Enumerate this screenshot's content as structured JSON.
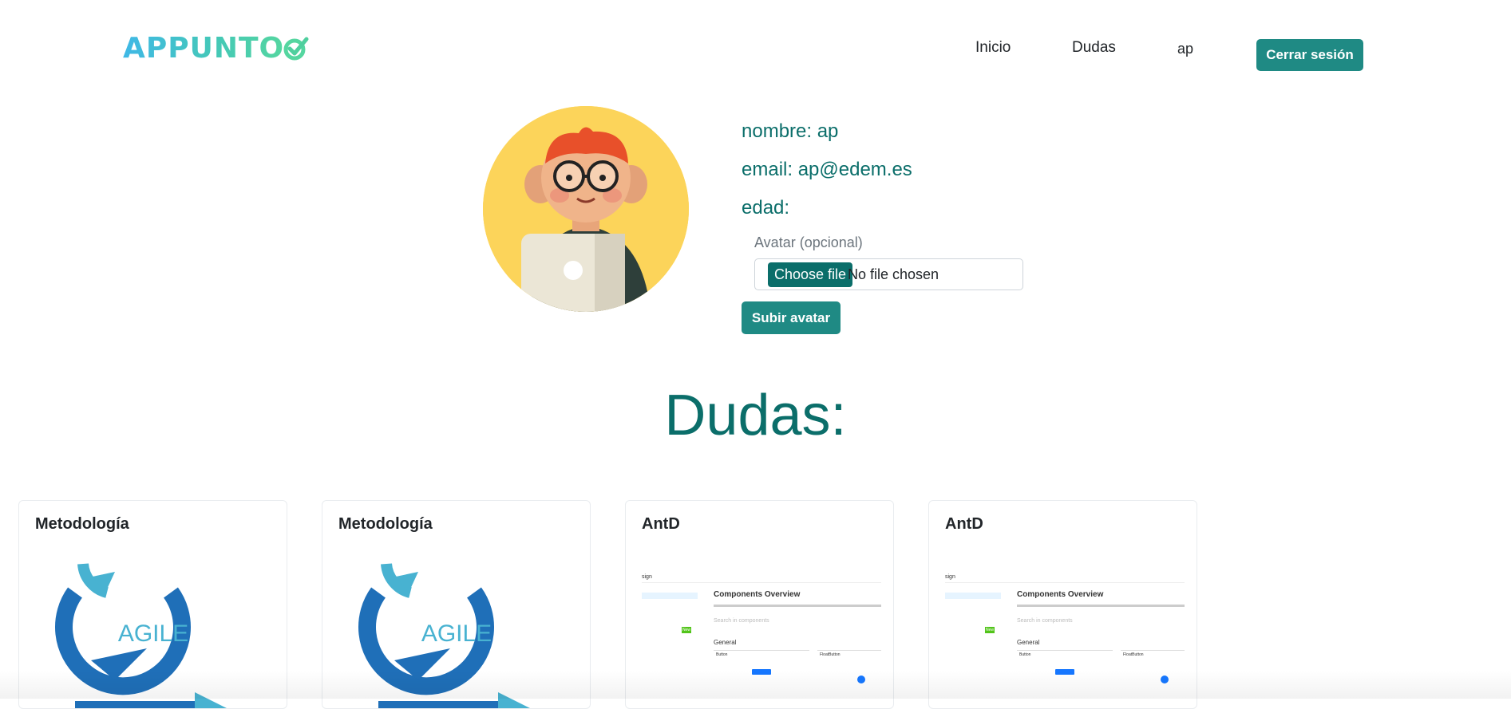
{
  "brand": {
    "name": "APPUNTO"
  },
  "nav": {
    "inicio": "Inicio",
    "dudas": "Dudas",
    "user": "ap",
    "logout": "Cerrar sesión"
  },
  "profile": {
    "nombre": "nombre: ap",
    "email": "email: ap@edem.es",
    "edad": "edad:",
    "file_label": "Avatar (opcional)",
    "choose_file": "Choose file",
    "file_status": "No file chosen",
    "upload": "Subir avatar"
  },
  "section": {
    "title": "Dudas:"
  },
  "cards": [
    {
      "title": "Metodología",
      "image": "agile-logo",
      "image_text": "AGILE"
    },
    {
      "title": "Metodología",
      "image": "agile-logo",
      "image_text": "AGILE"
    },
    {
      "title": "AntD",
      "image": "antd-screenshot",
      "shot": {
        "brand": "sign",
        "heading": "Components Overview",
        "search": "Search in components",
        "group": "General",
        "col1": "Button",
        "col2": "FloatButton",
        "tag": "New"
      }
    },
    {
      "title": "AntD",
      "image": "antd-screenshot",
      "shot": {
        "brand": "sign",
        "heading": "Components Overview",
        "search": "Search in components",
        "group": "General",
        "col1": "Button",
        "col2": "FloatButton",
        "tag": "New"
      }
    }
  ],
  "colors": {
    "primary": "#1f8a84",
    "text_teal": "#0b6e6a",
    "avatar_bg": "#fcd45a"
  }
}
